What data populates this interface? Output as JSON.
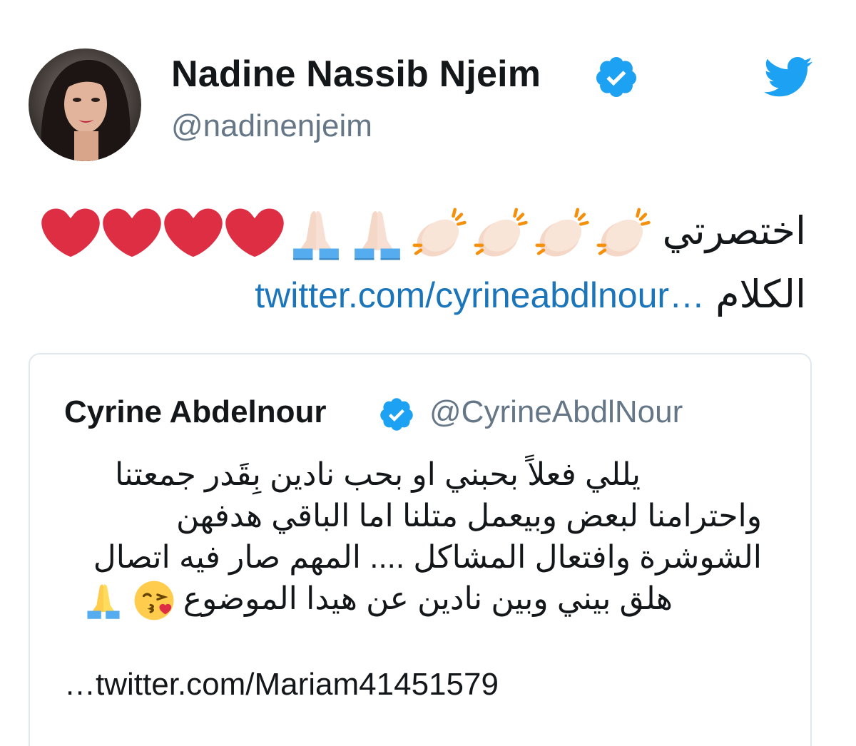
{
  "author": {
    "name": "Nadine Nassib Njeim",
    "handle": "@nadinenjeim",
    "verified": true
  },
  "tweet": {
    "text_word": "اختصرتي",
    "emojis": [
      "clapping-hands",
      "clapping-hands",
      "clapping-hands",
      "clapping-hands",
      "folded-hands",
      "folded-hands",
      "red-heart",
      "red-heart",
      "red-heart",
      "red-heart"
    ],
    "text_word_2": "الكلام",
    "link": "twitter.com/cyrineabdlnour…"
  },
  "quoted_tweet": {
    "name": "Cyrine Abdelnour",
    "handle": "@CyrineAbdlNour",
    "verified": true,
    "lines": [
      "يللي فعلاً بحبني او بحب نادين بِقَدر جمعتنا",
      "واحترامنا لبعض وبيعمل متلنا اما الباقي هدفهن",
      "الشوشرة وافتعال المشاكل .... المهم صار فيه اتصال",
      "هلق بيني وبين نادين عن هيدا الموضوع"
    ],
    "line4_emojis": [
      "face-blowing-kiss",
      "folded-hands"
    ],
    "link": "twitter.com/Mariam41451579…"
  },
  "colors": {
    "accent": "#1da1f2",
    "link": "#1b75bb",
    "secondary_text": "#657786",
    "border": "#e1e8ed",
    "heart": "#dd2e44"
  }
}
